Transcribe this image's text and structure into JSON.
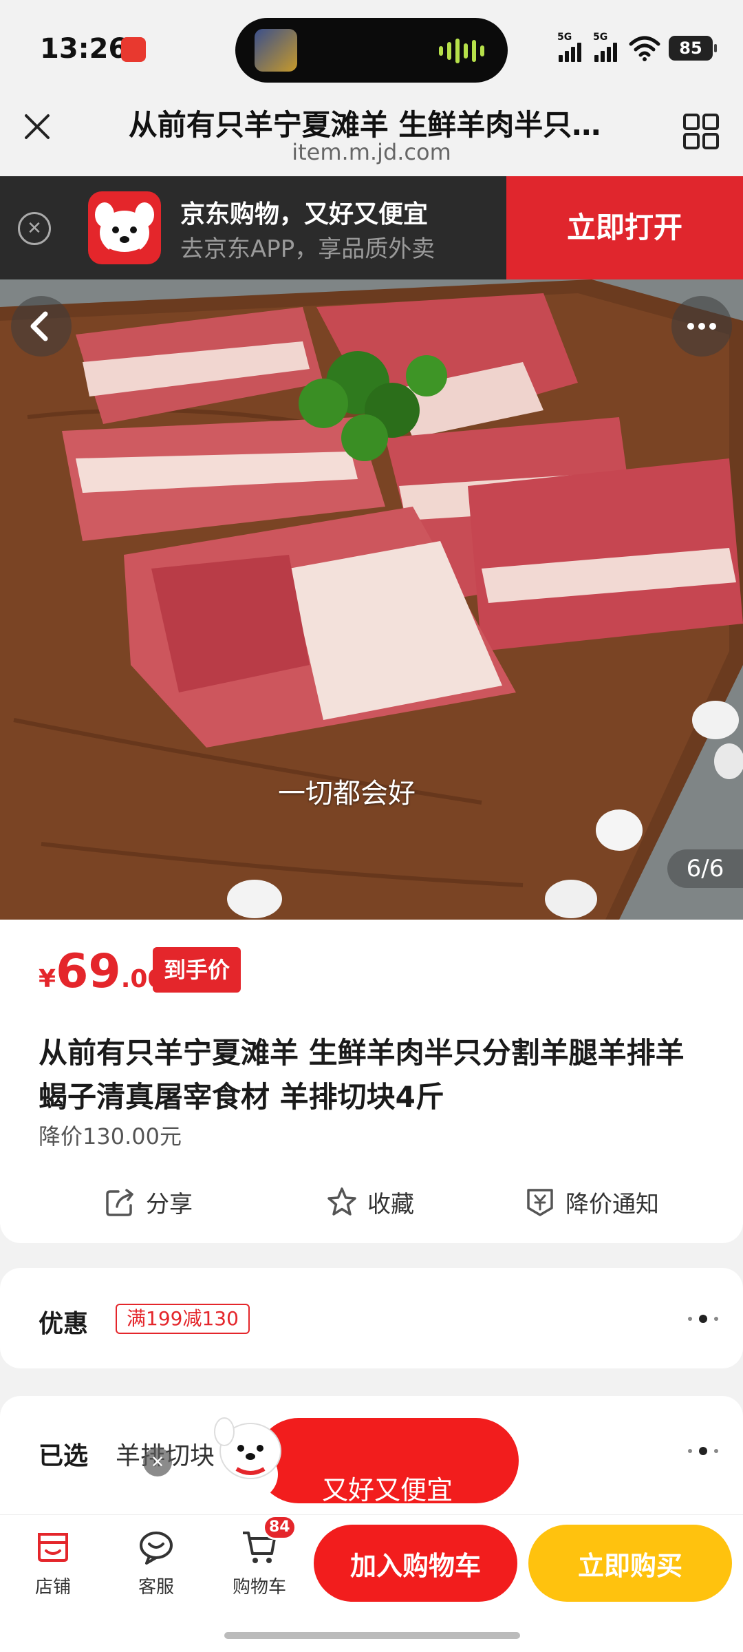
{
  "status": {
    "time": "13:26",
    "signal1": "5G",
    "signal2": "5G",
    "battery": "85"
  },
  "browser": {
    "title": "从前有只羊宁夏滩羊 生鲜羊肉半只…",
    "url": "item.m.jd.com"
  },
  "promo": {
    "title": "京东购物，又好又便宜",
    "subtitle": "去京东APP，享品质外卖",
    "open": "立即打开"
  },
  "hero": {
    "caption": "一切都会好",
    "page": "6/6"
  },
  "product": {
    "currency": "¥",
    "price_int": "69",
    "price_dec": ".00",
    "price_tag": "到手价",
    "title": "从前有只羊宁夏滩羊 生鲜羊肉半只分割羊腿羊排羊蝎子清真屠宰食材 羊排切块4斤",
    "drop_price": "降价130.00元",
    "actions": {
      "share": "分享",
      "favorite": "收藏",
      "notify": "降价通知"
    }
  },
  "discount": {
    "label": "优惠",
    "coupon": "满199减130"
  },
  "selected": {
    "label": "已选",
    "value": "羊排切块"
  },
  "float": {
    "text": "又好又便宜"
  },
  "bottom": {
    "shop": "店铺",
    "service": "客服",
    "cart": "购物车",
    "cart_count": "84",
    "add_cart": "加入购物车",
    "buy_now": "立即购买"
  },
  "colors": {
    "brand_red": "#e4262b",
    "buy_yellow": "#ffc20e",
    "banner_dark": "#2b2b2b"
  }
}
